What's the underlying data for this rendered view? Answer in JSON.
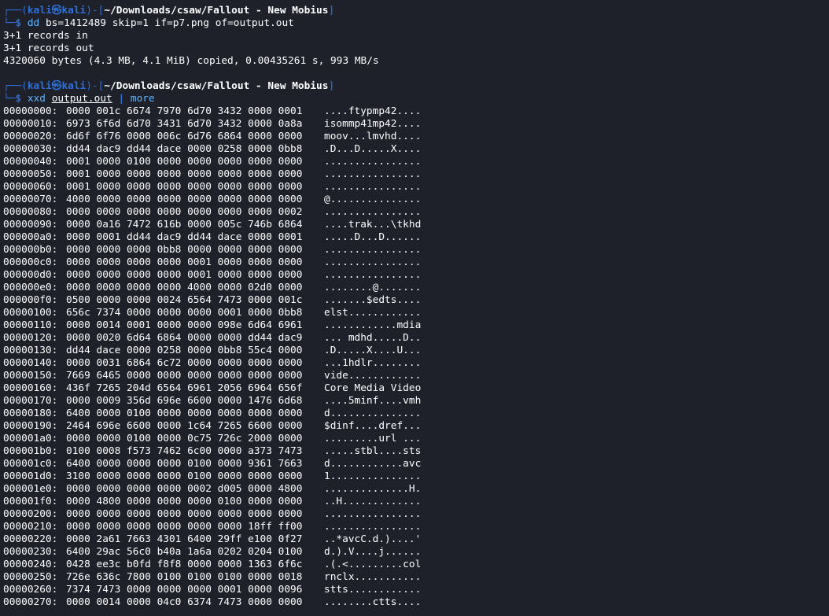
{
  "prompt1": {
    "frame_top": "┌──(",
    "user": "kali㉿kali",
    "frame_mid": ")-[",
    "path": "~/Downloads/csaw/Fallout - New Mobius",
    "frame_end": "]",
    "frame_bottom": "└─",
    "dollar": "$ ",
    "cmd": "dd",
    "args": " bs=1412489 skip=1 if=p7.png of=output.out"
  },
  "dd_output": [
    "3+1 records in",
    "3+1 records out",
    "4320060 bytes (4.3 MB, 4.1 MiB) copied, 0.00435261 s, 993 MB/s"
  ],
  "prompt2": {
    "frame_top": "┌──(",
    "user": "kali㉿kali",
    "frame_mid": ")-[",
    "path": "~/Downloads/csaw/Fallout - New Mobius",
    "frame_end": "]",
    "frame_bottom": "└─",
    "dollar": "$ ",
    "cmd": "xxd",
    "file": "output.out",
    "pipe": "|",
    "more": "more"
  },
  "hexdump": [
    {
      "offset": "00000000:",
      "bytes": "0000 001c 6674 7970 6d70 3432 0000 0001",
      "ascii": "....ftypmp42...."
    },
    {
      "offset": "00000010:",
      "bytes": "6973 6f6d 6d70 3431 6d70 3432 0000 0a8a",
      "ascii": "isommp41mp42...."
    },
    {
      "offset": "00000020:",
      "bytes": "6d6f 6f76 0000 006c 6d76 6864 0000 0000",
      "ascii": "moov...lmvhd...."
    },
    {
      "offset": "00000030:",
      "bytes": "dd44 dac9 dd44 dace 0000 0258 0000 0bb8",
      "ascii": ".D...D.....X...."
    },
    {
      "offset": "00000040:",
      "bytes": "0001 0000 0100 0000 0000 0000 0000 0000",
      "ascii": "................"
    },
    {
      "offset": "00000050:",
      "bytes": "0001 0000 0000 0000 0000 0000 0000 0000",
      "ascii": "................"
    },
    {
      "offset": "00000060:",
      "bytes": "0001 0000 0000 0000 0000 0000 0000 0000",
      "ascii": "................"
    },
    {
      "offset": "00000070:",
      "bytes": "4000 0000 0000 0000 0000 0000 0000 0000",
      "ascii": "@..............."
    },
    {
      "offset": "00000080:",
      "bytes": "0000 0000 0000 0000 0000 0000 0000 0002",
      "ascii": "................"
    },
    {
      "offset": "00000090:",
      "bytes": "0000 0a16 7472 616b 0000 005c 746b 6864",
      "ascii": "....trak...\\tkhd"
    },
    {
      "offset": "000000a0:",
      "bytes": "0000 0001 dd44 dac9 dd44 dace 0000 0001",
      "ascii": ".....D...D......"
    },
    {
      "offset": "000000b0:",
      "bytes": "0000 0000 0000 0bb8 0000 0000 0000 0000",
      "ascii": "................"
    },
    {
      "offset": "000000c0:",
      "bytes": "0000 0000 0000 0000 0001 0000 0000 0000",
      "ascii": "................"
    },
    {
      "offset": "000000d0:",
      "bytes": "0000 0000 0000 0000 0001 0000 0000 0000",
      "ascii": "................"
    },
    {
      "offset": "000000e0:",
      "bytes": "0000 0000 0000 0000 4000 0000 02d0 0000",
      "ascii": "........@......."
    },
    {
      "offset": "000000f0:",
      "bytes": "0500 0000 0000 0024 6564 7473 0000 001c",
      "ascii": ".......$edts...."
    },
    {
      "offset": "00000100:",
      "bytes": "656c 7374 0000 0000 0000 0001 0000 0bb8",
      "ascii": "elst............"
    },
    {
      "offset": "00000110:",
      "bytes": "0000 0014 0001 0000 0000 098e 6d64 6961",
      "ascii": "............mdia"
    },
    {
      "offset": "00000120:",
      "bytes": "0000 0020 6d64 6864 0000 0000 dd44 dac9",
      "ascii": "... mdhd.....D.."
    },
    {
      "offset": "00000130:",
      "bytes": "dd44 dace 0000 0258 0000 0bb8 55c4 0000",
      "ascii": ".D.....X....U..."
    },
    {
      "offset": "00000140:",
      "bytes": "0000 0031 6864 6c72 0000 0000 0000 0000",
      "ascii": "...1hdlr........"
    },
    {
      "offset": "00000150:",
      "bytes": "7669 6465 0000 0000 0000 0000 0000 0000",
      "ascii": "vide............"
    },
    {
      "offset": "00000160:",
      "bytes": "436f 7265 204d 6564 6961 2056 6964 656f",
      "ascii": "Core Media Video"
    },
    {
      "offset": "00000170:",
      "bytes": "0000 0009 356d 696e 6600 0000 1476 6d68",
      "ascii": "....5minf....vmh"
    },
    {
      "offset": "00000180:",
      "bytes": "6400 0000 0100 0000 0000 0000 0000 0000",
      "ascii": "d..............."
    },
    {
      "offset": "00000190:",
      "bytes": "2464 696e 6600 0000 1c64 7265 6600 0000",
      "ascii": "$dinf....dref..."
    },
    {
      "offset": "000001a0:",
      "bytes": "0000 0000 0100 0000 0c75 726c 2000 0000",
      "ascii": ".........url ..."
    },
    {
      "offset": "000001b0:",
      "bytes": "0100 0008 f573 7462 6c00 0000 a373 7473",
      "ascii": ".....stbl....sts"
    },
    {
      "offset": "000001c0:",
      "bytes": "6400 0000 0000 0000 0100 0000 9361 7663",
      "ascii": "d............avc"
    },
    {
      "offset": "000001d0:",
      "bytes": "3100 0000 0000 0000 0100 0000 0000 0000",
      "ascii": "1..............."
    },
    {
      "offset": "000001e0:",
      "bytes": "0000 0000 0000 0000 0002 d005 0000 4800",
      "ascii": "..............H."
    },
    {
      "offset": "000001f0:",
      "bytes": "0000 4800 0000 0000 0000 0100 0000 0000",
      "ascii": "..H............."
    },
    {
      "offset": "00000200:",
      "bytes": "0000 0000 0000 0000 0000 0000 0000 0000",
      "ascii": "................"
    },
    {
      "offset": "00000210:",
      "bytes": "0000 0000 0000 0000 0000 0000 18ff ff00",
      "ascii": "................"
    },
    {
      "offset": "00000220:",
      "bytes": "0000 2a61 7663 4301 6400 29ff e100 0f27",
      "ascii": "..*avcC.d.)....'"
    },
    {
      "offset": "00000230:",
      "bytes": "6400 29ac 56c0 b40a 1a6a 0202 0204 0100",
      "ascii": "d.).V....j......"
    },
    {
      "offset": "00000240:",
      "bytes": "0428 ee3c b0fd f8f8 0000 0000 1363 6f6c",
      "ascii": ".(.<.........col"
    },
    {
      "offset": "00000250:",
      "bytes": "726e 636c 7800 0100 0100 0100 0000 0018",
      "ascii": "rnclx..........."
    },
    {
      "offset": "00000260:",
      "bytes": "7374 7473 0000 0000 0000 0001 0000 0096",
      "ascii": "stts............"
    },
    {
      "offset": "00000270:",
      "bytes": "0000 0014 0000 04c0 6374 7473 0000 0000",
      "ascii": "........ctts...."
    }
  ]
}
